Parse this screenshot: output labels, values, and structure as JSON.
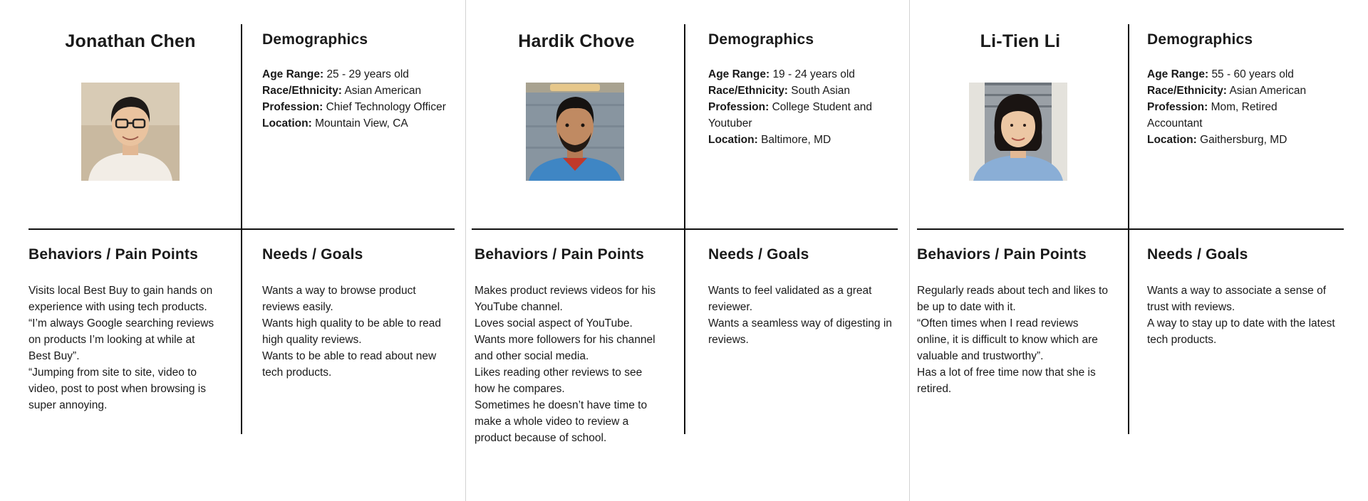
{
  "personas": [
    {
      "name": "Jonathan Chen",
      "photo_icon": "person-photo",
      "demographics": {
        "heading": "Demographics",
        "rows": [
          {
            "label": "Age Range:",
            "value": "25 - 29 years old"
          },
          {
            "label": "Race/Ethnicity:",
            "value": "Asian American"
          },
          {
            "label": "Profession:",
            "value": "Chief Technology Officer"
          },
          {
            "label": "Location:",
            "value": "Mountain View, CA"
          }
        ]
      },
      "behaviors": {
        "heading": "Behaviors / Pain Points",
        "items": [
          "Visits local Best Buy to gain hands on experience with using tech products.",
          "“I’m always Google searching reviews on products I’m looking at while at Best Buy”.",
          "“Jumping from site to site, video to video, post to post when browsing is super annoying."
        ]
      },
      "needs": {
        "heading": "Needs / Goals",
        "items": [
          "Wants a way to browse product reviews easily.",
          "Wants high quality to be able to read high quality reviews.",
          "Wants to be able to read about new tech products."
        ]
      }
    },
    {
      "name": "Hardik Chove",
      "photo_icon": "person-photo",
      "demographics": {
        "heading": "Demographics",
        "rows": [
          {
            "label": "Age Range:",
            "value": "19 - 24 years old"
          },
          {
            "label": "Race/Ethnicity:",
            "value": "South Asian"
          },
          {
            "label": "Profession:",
            "value": "College Student and Youtuber"
          },
          {
            "label": "Location:",
            "value": "Baltimore, MD"
          }
        ]
      },
      "behaviors": {
        "heading": "Behaviors / Pain Points",
        "items": [
          "Makes product reviews videos for his YouTube channel.",
          "Loves social aspect of YouTube.",
          "Wants more followers for his channel and other social media.",
          "Likes reading other reviews to see how he compares.",
          "Sometimes he doesn’t have time to make a whole video to review a product because of school."
        ]
      },
      "needs": {
        "heading": "Needs / Goals",
        "items": [
          "Wants to feel validated as a great reviewer.",
          "Wants a seamless way of digesting in reviews."
        ]
      }
    },
    {
      "name": "Li-Tien Li",
      "photo_icon": "person-photo",
      "demographics": {
        "heading": "Demographics",
        "rows": [
          {
            "label": "Age Range:",
            "value": "55 - 60 years old"
          },
          {
            "label": "Race/Ethnicity:",
            "value": "Asian American"
          },
          {
            "label": "Profession:",
            "value": "Mom, Retired Accountant"
          },
          {
            "label": "Location:",
            "value": "Gaithersburg, MD"
          }
        ]
      },
      "behaviors": {
        "heading": "Behaviors / Pain Points",
        "items": [
          "Regularly reads about tech and likes to be up to date with it.",
          "“Often times when I read reviews online, it is difficult to know which are valuable and trustworthy”.",
          "Has a lot of free time now that she is retired."
        ]
      },
      "needs": {
        "heading": "Needs / Goals",
        "items": [
          "Wants a way to associate a sense of trust with reviews.",
          "A way to stay up to date with the latest tech products."
        ]
      }
    }
  ]
}
